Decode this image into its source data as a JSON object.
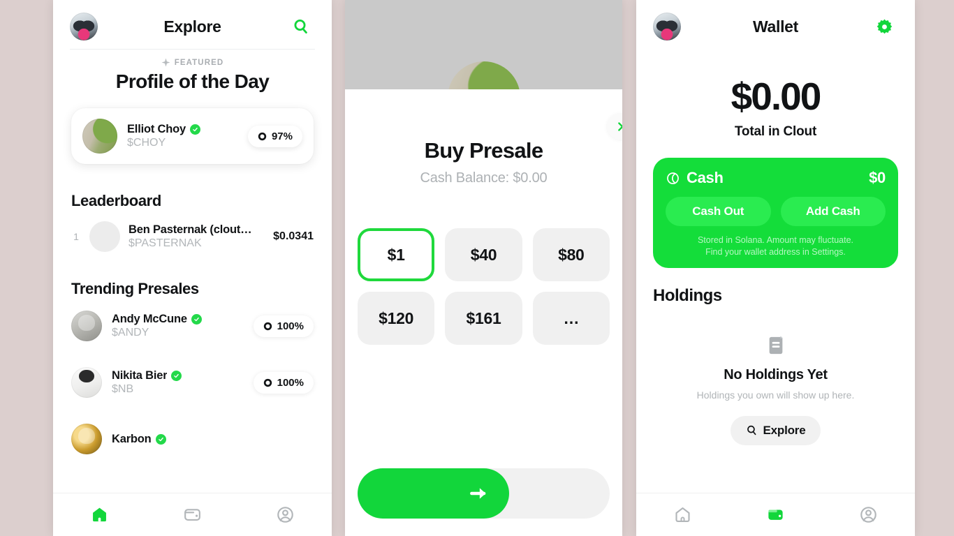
{
  "theme": {
    "background": "#dccfce",
    "accent_green": "#14dd3a",
    "bright_green": "#1fd93c",
    "text_primary": "#111315",
    "text_muted": "#b0b4b7",
    "chip_gray": "#f0f0f0"
  },
  "explore": {
    "header": {
      "title": "Explore",
      "avatar": "user-avatar",
      "search_icon": "search-icon"
    },
    "featured": {
      "badge_icon": "sparkle-icon",
      "badge_label": "FEATURED",
      "title": "Profile of the Day"
    },
    "featured_card": {
      "name": "Elliot Choy",
      "ticker": "$CHOY",
      "verified": true,
      "pct": "97%"
    },
    "leaderboard": {
      "title": "Leaderboard",
      "rows": [
        {
          "rank": "1",
          "name": "Ben Pasternak (clout…",
          "ticker": "$PASTERNAK",
          "price": "$0.0341"
        }
      ]
    },
    "trending": {
      "title": "Trending Presales",
      "rows": [
        {
          "name": "Andy McCune",
          "ticker": "$ANDY",
          "verified": true,
          "pct": "100%"
        },
        {
          "name": "Nikita Bier",
          "ticker": "$NB",
          "verified": true,
          "pct": "100%"
        },
        {
          "name": "Karbon",
          "ticker": "",
          "verified": true,
          "pct": ""
        }
      ]
    },
    "tabs": [
      {
        "name": "home-tab",
        "icon": "home-icon",
        "active": true
      },
      {
        "name": "wallet-tab",
        "icon": "wallet-icon",
        "active": false
      },
      {
        "name": "profile-tab",
        "icon": "profile-icon",
        "active": false
      }
    ]
  },
  "buy": {
    "chevron_icon": "chevron-right-icon",
    "title": "Buy Presale",
    "subtitle": "Cash Balance: $0.00",
    "amounts": [
      {
        "label": "$1",
        "selected": true
      },
      {
        "label": "$40",
        "selected": false
      },
      {
        "label": "$80",
        "selected": false
      },
      {
        "label": "$120",
        "selected": false
      },
      {
        "label": "$161",
        "selected": false
      },
      {
        "label": "…",
        "selected": false
      }
    ],
    "slider": {
      "icon": "arrow-right-icon",
      "progress": 60
    }
  },
  "wallet": {
    "header": {
      "title": "Wallet",
      "avatar": "user-avatar",
      "settings_icon": "gear-icon"
    },
    "balance": "$0.00",
    "balance_label": "Total in Clout",
    "cash_card": {
      "icon": "cash-coin-icon",
      "label": "Cash",
      "amount": "$0",
      "cash_out_label": "Cash Out",
      "add_cash_label": "Add Cash",
      "note_line1": "Stored in Solana. Amount may fluctuate.",
      "note_line2": "Find your wallet address in Settings."
    },
    "holdings": {
      "title": "Holdings",
      "empty_icon": "notebook-icon",
      "empty_title": "No Holdings Yet",
      "empty_sub": "Holdings you own will show up here.",
      "explore_icon": "search-icon",
      "explore_label": "Explore"
    },
    "tabs": [
      {
        "name": "home-tab",
        "icon": "home-icon",
        "active": false
      },
      {
        "name": "wallet-tab",
        "icon": "wallet-icon",
        "active": true
      },
      {
        "name": "profile-tab",
        "icon": "profile-icon",
        "active": false
      }
    ]
  }
}
